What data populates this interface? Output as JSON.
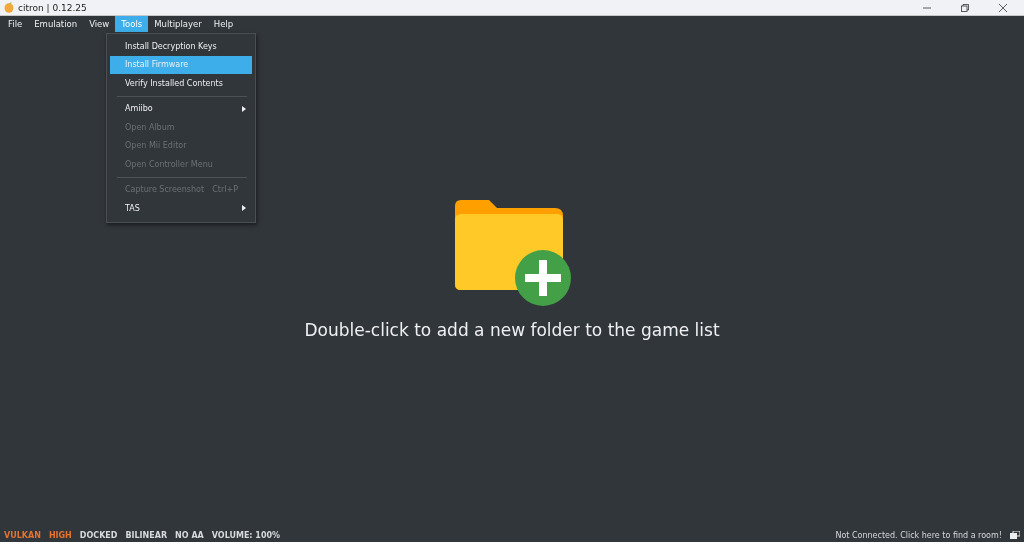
{
  "window": {
    "title": "citron | 0.12.25"
  },
  "menu_bar": [
    {
      "label": "File",
      "selected": false
    },
    {
      "label": "Emulation",
      "selected": false
    },
    {
      "label": "View",
      "selected": false
    },
    {
      "label": "Tools",
      "selected": true
    },
    {
      "label": "Multiplayer",
      "selected": false
    },
    {
      "label": "Help",
      "selected": false
    }
  ],
  "tools_menu": [
    {
      "kind": "item",
      "label": "Install Decryption Keys",
      "selected": false,
      "disabled": false
    },
    {
      "kind": "item",
      "label": "Install Firmware",
      "selected": true,
      "disabled": false
    },
    {
      "kind": "item",
      "label": "Verify Installed Contents",
      "selected": false,
      "disabled": false
    },
    {
      "kind": "separator"
    },
    {
      "kind": "submenu",
      "label": "Amiibo",
      "selected": false,
      "disabled": false
    },
    {
      "kind": "item",
      "label": "Open Album",
      "selected": false,
      "disabled": true
    },
    {
      "kind": "item",
      "label": "Open Mii Editor",
      "selected": false,
      "disabled": true
    },
    {
      "kind": "item",
      "label": "Open Controller Menu",
      "selected": false,
      "disabled": true
    },
    {
      "kind": "separator"
    },
    {
      "kind": "item",
      "label": "Capture Screenshot",
      "shortcut": "Ctrl+P",
      "selected": false,
      "disabled": true
    },
    {
      "kind": "submenu",
      "label": "TAS",
      "selected": false,
      "disabled": false
    }
  ],
  "game_list": {
    "empty_message": "Double-click to add a new folder to the game list"
  },
  "status_bar": {
    "items": [
      {
        "label": "VULKAN",
        "color": "#e5732e"
      },
      {
        "label": "HIGH",
        "color": "#e5732e"
      },
      {
        "label": "DOCKED",
        "color": "#d8dadc"
      },
      {
        "label": "BILINEAR",
        "color": "#d8dadc"
      },
      {
        "label": "NO AA",
        "color": "#d8dadc"
      },
      {
        "label": "VOLUME: 100%",
        "color": "#d8dadc"
      }
    ],
    "multiplayer": "Not Connected. Click here to find a room!"
  }
}
